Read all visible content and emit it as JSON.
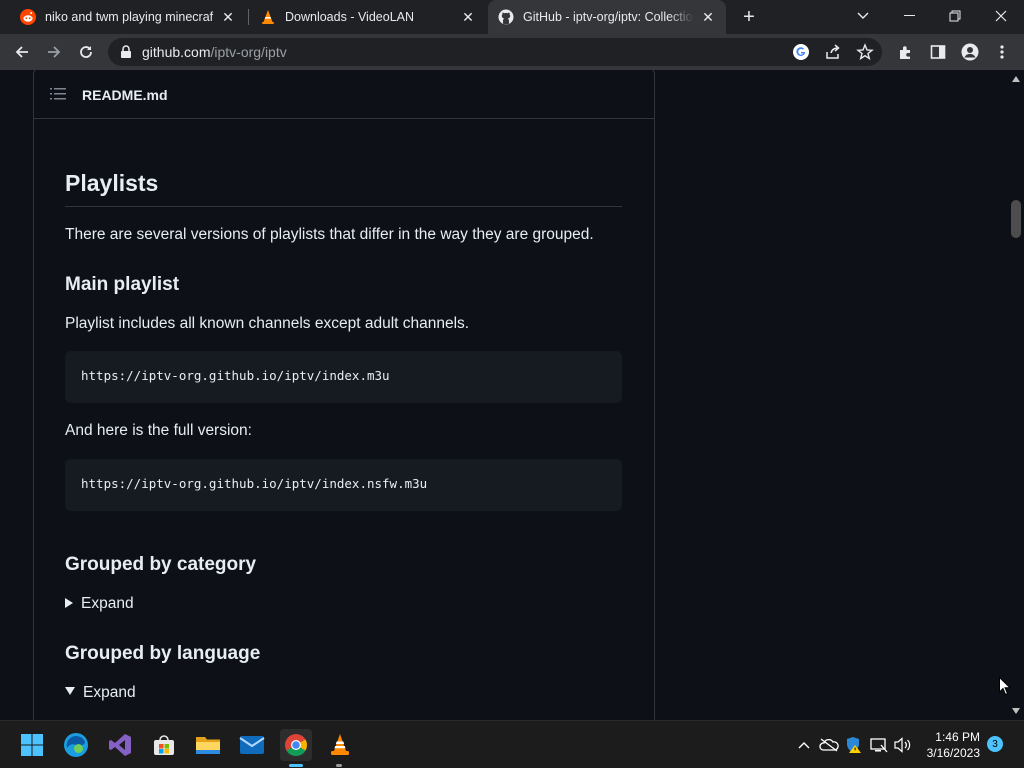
{
  "browser": {
    "tabs": [
      {
        "title": "niko and twm playing minecraf : o",
        "icon": "reddit-icon",
        "active": false
      },
      {
        "title": "Downloads - VideoLAN",
        "icon": "vlc-cone-icon",
        "active": false
      },
      {
        "title": "GitHub - iptv-org/iptv: Collection",
        "icon": "github-icon",
        "active": true
      }
    ],
    "new_tab": "+",
    "address": {
      "host": "github.com",
      "path": "/iptv-org/iptv"
    }
  },
  "readme": {
    "header_title": "README.md",
    "heading": "Playlists",
    "intro": "There are several versions of playlists that differ in the way they are grouped.",
    "main_playlist": {
      "heading": "Main playlist",
      "description": "Playlist includes all known channels except adult channels.",
      "url": "https://iptv-org.github.io/iptv/index.m3u",
      "full_text": "And here is the full version:",
      "full_url": "https://iptv-org.github.io/iptv/index.nsfw.m3u"
    },
    "by_category": {
      "heading": "Grouped by category",
      "summary": "Expand",
      "expanded": false
    },
    "by_language": {
      "heading": "Grouped by language",
      "summary": "Expand",
      "expanded": true
    }
  },
  "taskbar": {
    "apps": [
      "start-icon",
      "edge-icon",
      "visual-studio-icon",
      "store-icon",
      "file-explorer-icon",
      "mail-icon",
      "chrome-icon",
      "vlc-icon"
    ],
    "time": "1:46 PM",
    "date": "3/16/2023",
    "notifications": "3"
  },
  "colors": {
    "page_bg": "#0d1117",
    "code_bg": "#161b22",
    "border": "#30363d",
    "text": "#e6edf3"
  }
}
